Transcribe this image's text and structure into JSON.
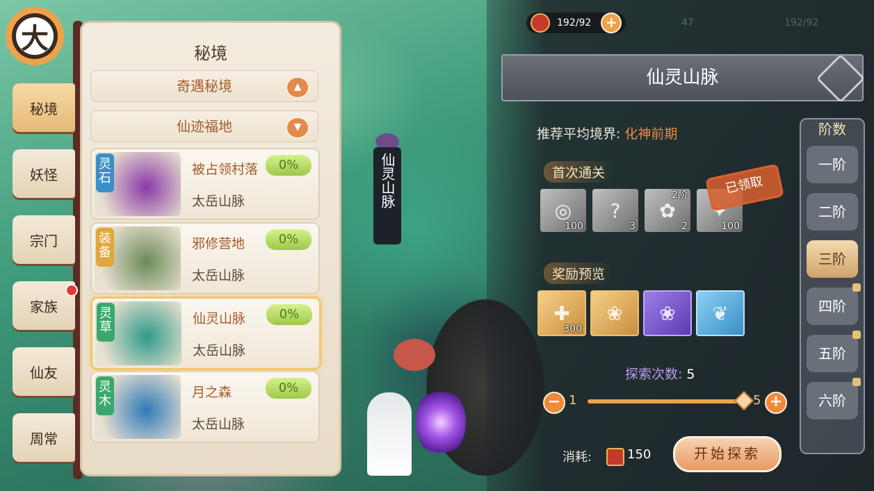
{
  "resource": {
    "stamina": "192/92",
    "plus": "+",
    "ghost1": "47",
    "ghost2": "192/92"
  },
  "avatar_glyph": "大",
  "tabs": [
    {
      "label": "秘境",
      "active": true
    },
    {
      "label": "妖怪"
    },
    {
      "label": "宗门"
    },
    {
      "label": "家族",
      "notify": true
    },
    {
      "label": "仙友"
    },
    {
      "label": "周常"
    }
  ],
  "panel": {
    "title": "秘境",
    "categories": [
      {
        "label": "奇遇秘境",
        "arrow": "▲"
      },
      {
        "label": "仙迹福地",
        "arrow": "▼"
      }
    ],
    "realms": [
      {
        "type": "灵石",
        "name": "被占领村落",
        "location": "太岳山脉",
        "progress": "0%",
        "type_color": "#3a8fc8",
        "art_color": "#8a3aa8"
      },
      {
        "type": "装备",
        "name": "邪修营地",
        "location": "太岳山脉",
        "progress": "0%",
        "type_color": "#e0a73a",
        "art_color": "#6c8a5a"
      },
      {
        "type": "灵草",
        "name": "仙灵山脉",
        "location": "太岳山脉",
        "progress": "0%",
        "type_color": "#3aa86c",
        "art_color": "#2f9a8a",
        "selected": true
      },
      {
        "type": "灵木",
        "name": "月之森",
        "location": "太岳山脉",
        "progress": "0%",
        "type_color": "#3aa86c",
        "art_color": "#2f7ab8"
      }
    ]
  },
  "map": {
    "pillar_text": "仙灵山脉"
  },
  "detail": {
    "title": "仙灵山脉",
    "recommend_label": "推荐平均境界:",
    "recommend_value": "化神前期",
    "first_clear_label": "首次通关",
    "claimed_stamp": "已领取",
    "first_clear_items": [
      {
        "count": "100",
        "icon": "scroll-icon",
        "glyph": "◎"
      },
      {
        "count": "3",
        "icon": "chest-icon",
        "glyph": "?"
      },
      {
        "count": "2",
        "tier": "2阶",
        "icon": "herb-icon",
        "glyph": "✿"
      },
      {
        "count": "100",
        "icon": "talisman-icon",
        "glyph": "✦"
      }
    ],
    "reward_label": "奖励预览",
    "reward_items": [
      {
        "count": "300",
        "style": "gold",
        "icon": "token-icon",
        "glyph": "✚"
      },
      {
        "count": "",
        "style": "gold",
        "icon": "herb-bundle-icon",
        "glyph": "❀"
      },
      {
        "count": "",
        "style": "purple",
        "icon": "purple-herb-icon",
        "glyph": "❀"
      },
      {
        "count": "",
        "style": "blue",
        "icon": "lily-icon",
        "glyph": "❦"
      }
    ],
    "explore_label": "探索次数:",
    "explore_value": "5",
    "slider_min": "1",
    "slider_max": "5",
    "minus": "−",
    "plus": "+",
    "cost_label": "消耗:",
    "cost_value": "150",
    "start_button": "开始探索"
  },
  "tiers": {
    "header": "阶数",
    "items": [
      {
        "label": "一阶"
      },
      {
        "label": "二阶"
      },
      {
        "label": "三阶",
        "active": true
      },
      {
        "label": "四阶",
        "locked": true
      },
      {
        "label": "五阶",
        "locked": true
      },
      {
        "label": "六阶",
        "locked": true
      }
    ]
  }
}
